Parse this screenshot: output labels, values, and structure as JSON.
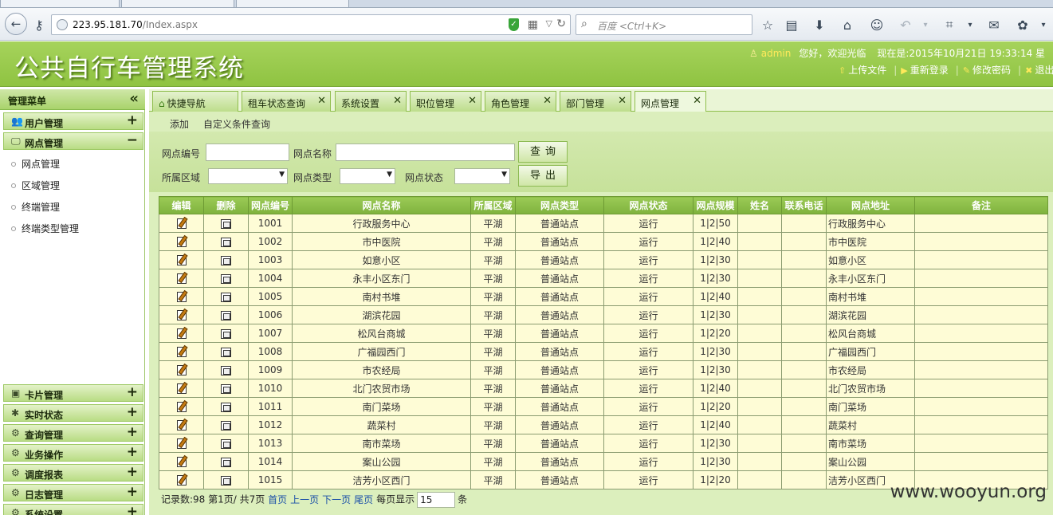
{
  "browser": {
    "url_host": "223.95.181.70",
    "url_path": "/Index.aspx",
    "search_placeholder": "百度 <Ctrl+K>"
  },
  "header": {
    "title": "公共自行车管理系统",
    "user_icon": "user-icon",
    "username": "admin",
    "greeting": "您好，欢迎光临",
    "datetime": "现在是:2015年10月21日 19:33:14 星",
    "links": [
      {
        "icon": "upload-icon",
        "glyph": "⇧",
        "label": "上传文件"
      },
      {
        "icon": "relogin-icon",
        "glyph": "▶",
        "label": "重新登录"
      },
      {
        "icon": "password-icon",
        "glyph": "✎",
        "label": "修改密码"
      },
      {
        "icon": "logout-icon",
        "glyph": "✖",
        "label": "退出"
      }
    ]
  },
  "sidebar": {
    "title": "管理菜单",
    "collapse_glyph": "«",
    "top_sections": [
      {
        "icon": "users-icon",
        "glyph": "👥",
        "label": "用户管理",
        "state": "+"
      },
      {
        "icon": "monitor-icon",
        "glyph": "🖵",
        "label": "网点管理",
        "state": "−"
      }
    ],
    "subitems": [
      "网点管理",
      "区域管理",
      "终端管理",
      "终端类型管理"
    ],
    "bottom_sections": [
      {
        "icon": "card-icon",
        "glyph": "▣",
        "label": "卡片管理",
        "state": "+"
      },
      {
        "icon": "realtime-icon",
        "glyph": "✱",
        "label": "实时状态",
        "state": "+"
      },
      {
        "icon": "gear-icon",
        "glyph": "⚙",
        "label": "查询管理",
        "state": "+"
      },
      {
        "icon": "gear-icon",
        "glyph": "⚙",
        "label": "业务操作",
        "state": "+"
      },
      {
        "icon": "gear-icon",
        "glyph": "⚙",
        "label": "调度报表",
        "state": "+"
      },
      {
        "icon": "gear-icon",
        "glyph": "⚙",
        "label": "日志管理",
        "state": "+"
      },
      {
        "icon": "gear-icon",
        "glyph": "⚙",
        "label": "系统设置",
        "state": "+"
      }
    ]
  },
  "tabs": [
    {
      "label": "快捷导航",
      "closable": false
    },
    {
      "label": "租车状态查询",
      "closable": true
    },
    {
      "label": "系统设置",
      "closable": true
    },
    {
      "label": "职位管理",
      "closable": true
    },
    {
      "label": "角色管理",
      "closable": true
    },
    {
      "label": "部门管理",
      "closable": true
    },
    {
      "label": "网点管理",
      "closable": true,
      "active": true
    }
  ],
  "subbar": {
    "add": "添加",
    "custom_query": "自定义条件查询"
  },
  "filter": {
    "site_no_label": "网点编号",
    "site_no_value": "",
    "site_name_label": "网点名称",
    "site_name_value": "",
    "area_label": "所属区域",
    "area_value": "",
    "type_label": "网点类型",
    "type_value": "",
    "status_label": "网点状态",
    "status_value": "",
    "query_button": "查询",
    "export_button": "导出"
  },
  "table": {
    "columns": [
      "编辑",
      "删除",
      "网点编号",
      "网点名称",
      "所属区域",
      "网点类型",
      "网点状态",
      "网点规模",
      "姓名",
      "联系电话",
      "网点地址",
      "备注"
    ],
    "rows": [
      {
        "no": "1001",
        "name": "行政服务中心",
        "area": "平湖",
        "type": "普通站点",
        "status": "运行",
        "scale": "1|2|50",
        "person": "",
        "phone": "",
        "address": "行政服务中心",
        "note": ""
      },
      {
        "no": "1002",
        "name": "市中医院",
        "area": "平湖",
        "type": "普通站点",
        "status": "运行",
        "scale": "1|2|40",
        "person": "",
        "phone": "",
        "address": "市中医院",
        "note": ""
      },
      {
        "no": "1003",
        "name": "如意小区",
        "area": "平湖",
        "type": "普通站点",
        "status": "运行",
        "scale": "1|2|30",
        "person": "",
        "phone": "",
        "address": "如意小区",
        "note": ""
      },
      {
        "no": "1004",
        "name": "永丰小区东门",
        "area": "平湖",
        "type": "普通站点",
        "status": "运行",
        "scale": "1|2|30",
        "person": "",
        "phone": "",
        "address": "永丰小区东门",
        "note": ""
      },
      {
        "no": "1005",
        "name": "南村书堆",
        "area": "平湖",
        "type": "普通站点",
        "status": "运行",
        "scale": "1|2|40",
        "person": "",
        "phone": "",
        "address": "南村书堆",
        "note": ""
      },
      {
        "no": "1006",
        "name": "湖滨花园",
        "area": "平湖",
        "type": "普通站点",
        "status": "运行",
        "scale": "1|2|30",
        "person": "",
        "phone": "",
        "address": "湖滨花园",
        "note": ""
      },
      {
        "no": "1007",
        "name": "松风台商城",
        "area": "平湖",
        "type": "普通站点",
        "status": "运行",
        "scale": "1|2|20",
        "person": "",
        "phone": "",
        "address": "松风台商城",
        "note": ""
      },
      {
        "no": "1008",
        "name": "广福园西门",
        "area": "平湖",
        "type": "普通站点",
        "status": "运行",
        "scale": "1|2|30",
        "person": "",
        "phone": "",
        "address": "广福园西门",
        "note": ""
      },
      {
        "no": "1009",
        "name": "市农经局",
        "area": "平湖",
        "type": "普通站点",
        "status": "运行",
        "scale": "1|2|30",
        "person": "",
        "phone": "",
        "address": "市农经局",
        "note": ""
      },
      {
        "no": "1010",
        "name": "北门农贸市场",
        "area": "平湖",
        "type": "普通站点",
        "status": "运行",
        "scale": "1|2|40",
        "person": "",
        "phone": "",
        "address": "北门农贸市场",
        "note": ""
      },
      {
        "no": "1011",
        "name": "南门菜场",
        "area": "平湖",
        "type": "普通站点",
        "status": "运行",
        "scale": "1|2|20",
        "person": "",
        "phone": "",
        "address": "南门菜场",
        "note": ""
      },
      {
        "no": "1012",
        "name": "蔬菜村",
        "area": "平湖",
        "type": "普通站点",
        "status": "运行",
        "scale": "1|2|40",
        "person": "",
        "phone": "",
        "address": "蔬菜村",
        "note": ""
      },
      {
        "no": "1013",
        "name": "南市菜场",
        "area": "平湖",
        "type": "普通站点",
        "status": "运行",
        "scale": "1|2|30",
        "person": "",
        "phone": "",
        "address": "南市菜场",
        "note": ""
      },
      {
        "no": "1014",
        "name": "案山公园",
        "area": "平湖",
        "type": "普通站点",
        "status": "运行",
        "scale": "1|2|30",
        "person": "",
        "phone": "",
        "address": "案山公园",
        "note": ""
      },
      {
        "no": "1015",
        "name": "洁芳小区西门",
        "area": "平湖",
        "type": "普通站点",
        "status": "运行",
        "scale": "1|2|20",
        "person": "",
        "phone": "",
        "address": "洁芳小区西门",
        "note": ""
      }
    ]
  },
  "pager": {
    "summary": "记录数:98 第1页/ 共7页",
    "first": "首页",
    "prev": "上一页",
    "next": "下一页",
    "last": "尾页",
    "per_page_label": "每页显示",
    "per_page_value": "15",
    "unit": "条"
  },
  "watermark": "www.wooyun.org",
  "colors": {
    "header_green": "#8fc341",
    "row_bg": "#fefcd6",
    "table_head": "#7fb23d"
  }
}
